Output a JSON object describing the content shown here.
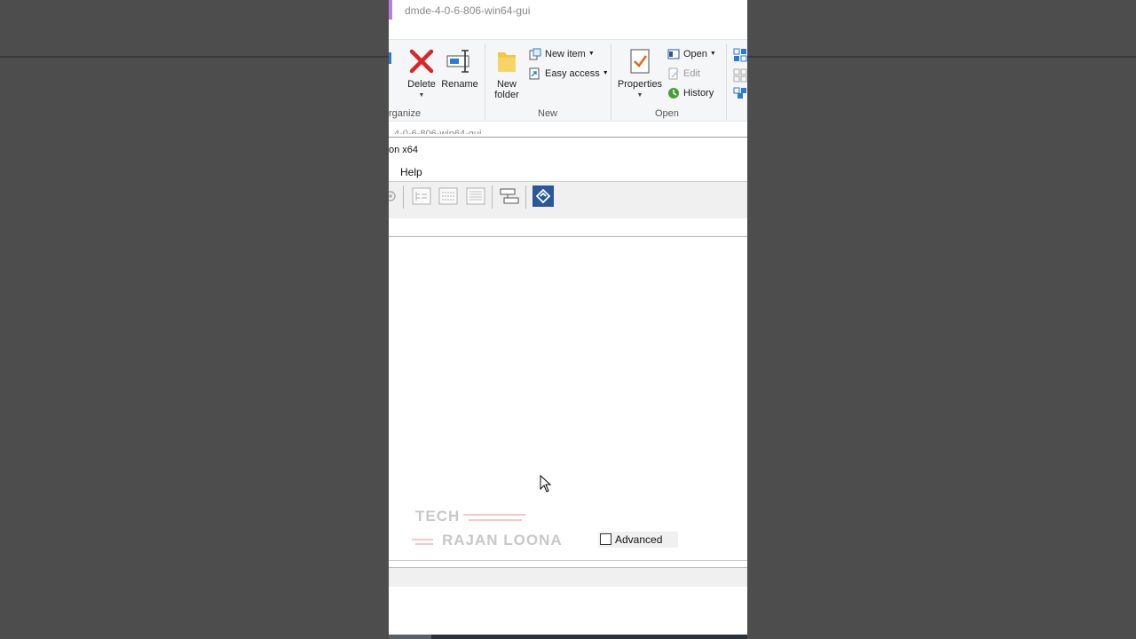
{
  "explorer": {
    "title": "dmde-4-0-6-806-win64-gui",
    "peek_text": "4-0-6-806-win64-gui",
    "groups": {
      "organize": {
        "label": "rganize",
        "delete_label": "Delete",
        "rename_label": "Rename"
      },
      "new": {
        "label": "New",
        "new_folder_line1": "New",
        "new_folder_line2": "folder",
        "new_item_label": "New item",
        "easy_access_label": "Easy access"
      },
      "open": {
        "label": "Open",
        "properties_label": "Properties",
        "open_label": "Open",
        "edit_label": "Edit",
        "history_label": "History"
      }
    }
  },
  "dmde": {
    "title_partial": "on x64",
    "menu": {
      "help_label": "Help"
    },
    "advanced_label": "Advanced",
    "advanced_checked": false
  },
  "watermark": {
    "line1": "TECH",
    "line2": "RAJAN LOONA"
  },
  "colors": {
    "delete_red": "#d9262b",
    "folder_yellow": "#f3c644",
    "accent_blue": "#2b5797",
    "title_accent": "#b87fd6",
    "background": "#4d4d4d"
  }
}
